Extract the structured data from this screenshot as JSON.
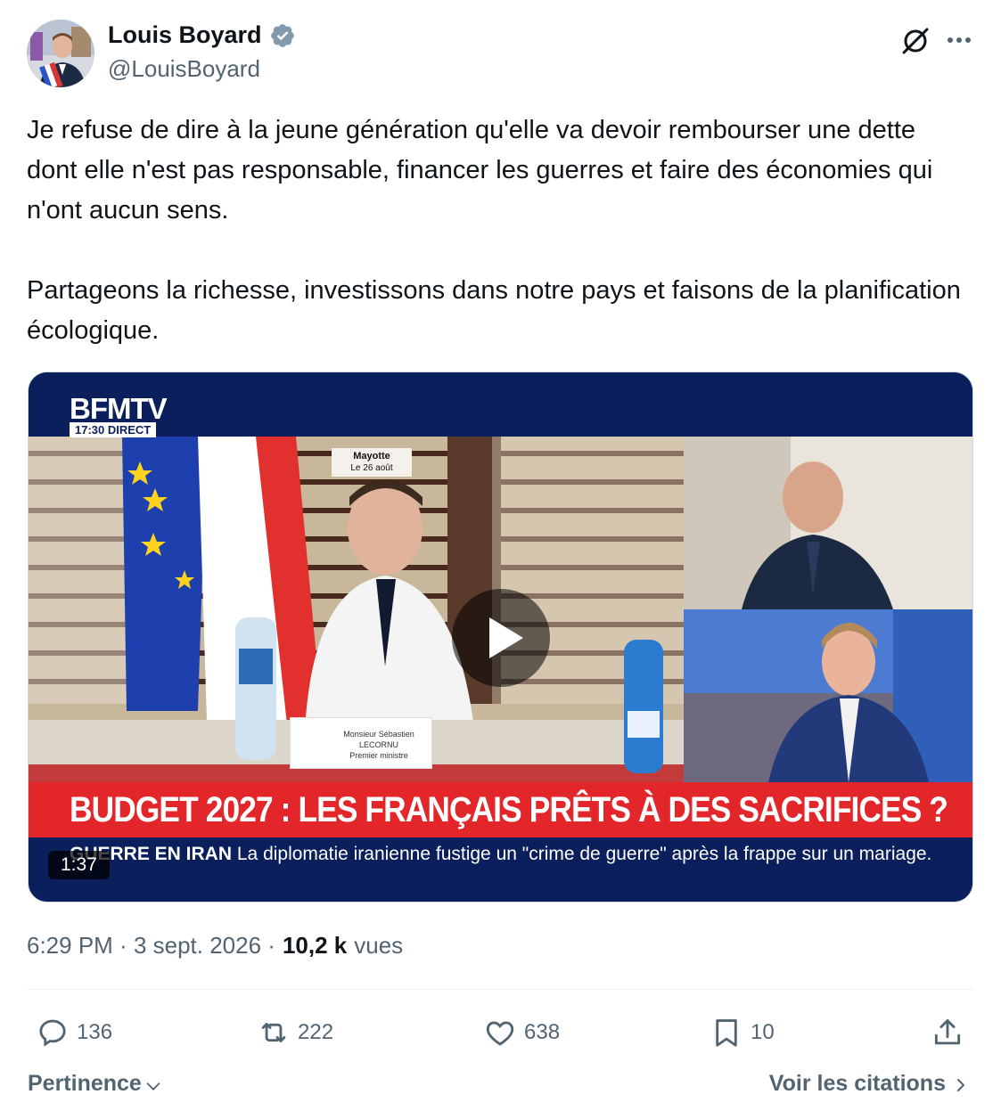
{
  "author": {
    "name": "Louis Boyard",
    "handle": "@LouisBoyard",
    "verified_color": "#829aab"
  },
  "tweet": {
    "text": "Je refuse de dire à la jeune génération qu'elle va devoir rembourser une dette dont elle n'est pas responsable, financer les guerres et faire des économies qui n'ont aucun sens.\n\nPartageons la richesse, investissons dans notre pays et faisons de la planification écologique."
  },
  "video": {
    "channel": "BFMTV",
    "channel_time": "17:30 DIRECT",
    "location": "Mayotte",
    "location_date": "Le 26 août",
    "nameplate_name": "Monsieur Sébastien LECORNU",
    "nameplate_role": "Premier ministre",
    "headline": "BUDGET 2027 : LES FRANÇAIS PRÊTS À DES SACRIFICES ?",
    "ticker_tag": "GUERRE EN IRAN",
    "ticker_text": "La diplomatie iranienne fustige un \"crime de guerre\" après la frappe sur un mariage.",
    "duration": "1:37",
    "headline_color": "#e2262a",
    "navy_color": "#0b1f5c"
  },
  "meta": {
    "time": "6:29 PM",
    "date": "3 sept. 2026",
    "views": "10,2 k",
    "views_label": "vues"
  },
  "actions": {
    "replies": "136",
    "retweets": "222",
    "likes": "638",
    "bookmarks": "10"
  },
  "footer": {
    "sort_label": "Pertinence",
    "quotes_label": "Voir les citations"
  },
  "icons": [
    "verified-icon",
    "grok-icon",
    "more-icon",
    "play-icon",
    "reply-icon",
    "retweet-icon",
    "like-icon",
    "bookmark-icon",
    "share-icon",
    "chevron-down-icon",
    "chevron-right-icon"
  ]
}
